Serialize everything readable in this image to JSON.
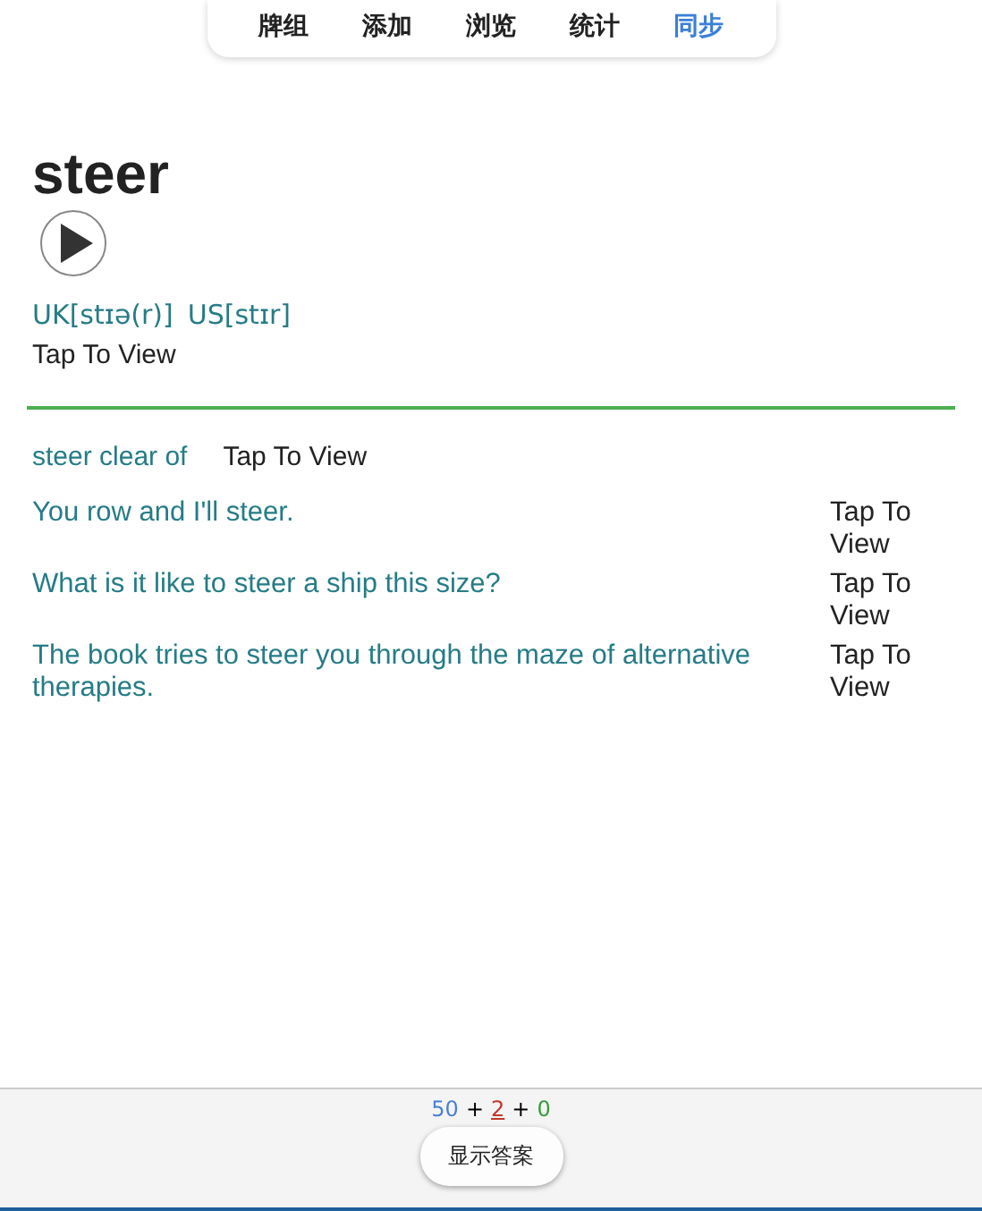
{
  "tabs": [
    {
      "label": "牌组",
      "selected": false
    },
    {
      "label": "添加",
      "selected": false
    },
    {
      "label": "浏览",
      "selected": false
    },
    {
      "label": "统计",
      "selected": false
    },
    {
      "label": "同步",
      "selected": true
    }
  ],
  "card": {
    "word": "steer",
    "phonetics": [
      "UK[stɪə(r)]",
      "US[stɪr]"
    ],
    "meaning": "Tap To View",
    "phrases": [
      {
        "text": "steer clear of",
        "meaning": "Tap To View"
      }
    ],
    "examples": [
      {
        "text": "You row and I'll steer.",
        "meaning": "Tap To View"
      },
      {
        "text": "What is it like to steer a ship this size?",
        "meaning": "Tap To View"
      },
      {
        "text": "The book tries to steer you through the maze of alternative therapies.",
        "meaning": "Tap To View"
      }
    ]
  },
  "footer": {
    "counts": [
      {
        "kind": "new",
        "value": "50",
        "selected": false
      },
      {
        "kind": "learn",
        "value": "2",
        "selected": true
      },
      {
        "kind": "review",
        "value": "0",
        "selected": false
      }
    ],
    "separators": [
      "+",
      "+"
    ],
    "button": "显示答案"
  }
}
